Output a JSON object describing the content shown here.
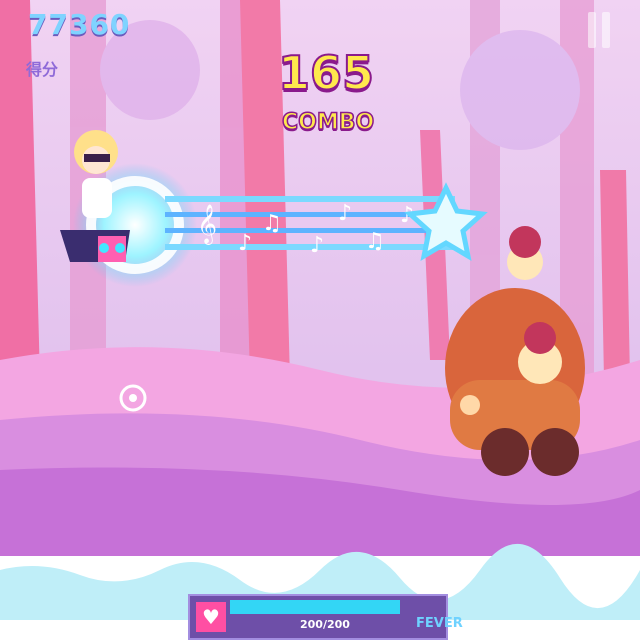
{
  "hud": {
    "score": "77360",
    "score_label": "得分",
    "combo_count": "165",
    "combo_label": "COMBO"
  },
  "fever": {
    "value_text": "200/200",
    "label": "FEVER",
    "fill_fraction": 1.0
  },
  "icons": {
    "pause": "pause-icon",
    "fever_heart": "heart-icon",
    "target": "star-target-icon"
  },
  "colors": {
    "sky": "#e6c4ef",
    "ground": "#d98ee0",
    "river": "#ffffff",
    "accent_pink": "#ff4fa3",
    "combo_yellow": "#ffe94d",
    "score_blue": "#7fd3ff",
    "fever_cyan": "#33d6f5"
  }
}
